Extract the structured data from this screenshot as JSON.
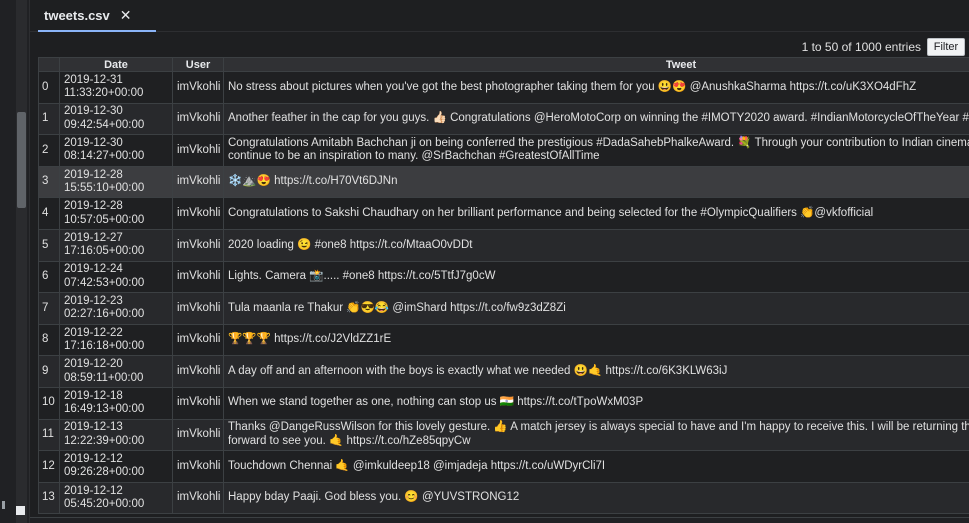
{
  "tab": {
    "title": "tweets.csv",
    "close_glyph": "✕"
  },
  "summary": "1 to 50 of 1000 entries",
  "filter_label": "Filter",
  "columns": [
    "",
    "Date",
    "User",
    "Tweet"
  ],
  "rows": [
    {
      "idx": "0",
      "date": "2019-12-31\n11:33:20+00:00",
      "user": "imVkohli",
      "tweet": "No stress about pictures when you've got the best photographer taking them for you 😃😍 @AnushkaSharma https://t.co/uK3XO4dFhZ"
    },
    {
      "idx": "1",
      "date": "2019-12-30\n09:42:54+00:00",
      "user": "imVkohli",
      "tweet": "Another feather in the cap for you guys. 👍🏻 Congratulations @HeroMotoCorp on winning the #IMOTY2020 award. #IndianMotorcycleOfTheYear #MakeNewTracks"
    },
    {
      "idx": "2",
      "date": "2019-12-30\n08:14:27+00:00",
      "user": "imVkohli",
      "tweet": "Congratulations Amitabh Bachchan ji on being conferred the prestigious #DadaSahebPhalkeAward. 💐 Through your contribution to Indian cinema, you have been and still continue to be an inspiration to many. @SrBachchan #GreatestOfAllTime"
    },
    {
      "idx": "3",
      "date": "2019-12-28\n15:55:10+00:00",
      "user": "imVkohli",
      "tweet": "❄️⛰️😍 https://t.co/H70Vt6DJNn"
    },
    {
      "idx": "4",
      "date": "2019-12-28\n10:57:05+00:00",
      "user": "imVkohli",
      "tweet": "Congratulations to Sakshi Chaudhary on her brilliant performance and being selected for the #OlympicQualifiers 👏@vkfofficial"
    },
    {
      "idx": "5",
      "date": "2019-12-27\n17:16:05+00:00",
      "user": "imVkohli",
      "tweet": "2020 loading 😉 #one8 https://t.co/MtaaO0vDDt"
    },
    {
      "idx": "6",
      "date": "2019-12-24\n07:42:53+00:00",
      "user": "imVkohli",
      "tweet": "Lights. Camera 📸..... #one8 https://t.co/5TtfJ7g0cW"
    },
    {
      "idx": "7",
      "date": "2019-12-23\n02:27:16+00:00",
      "user": "imVkohli",
      "tweet": "Tula maanla re Thakur 👏😎😂 @imShard https://t.co/fw9z3dZ8Zi"
    },
    {
      "idx": "8",
      "date": "2019-12-22\n17:16:18+00:00",
      "user": "imVkohli",
      "tweet": "🏆🏆🏆 https://t.co/J2VldZZ1rE"
    },
    {
      "idx": "9",
      "date": "2019-12-20\n08:59:11+00:00",
      "user": "imVkohli",
      "tweet": "A day off and an afternoon with the boys is exactly what we needed 😃🤙 https://t.co/6K3KLW63iJ"
    },
    {
      "idx": "10",
      "date": "2019-12-18\n16:49:13+00:00",
      "user": "imVkohli",
      "tweet": "When we stand together as one, nothing can stop us 🇮🇳 https://t.co/tTpoWxM03P"
    },
    {
      "idx": "11",
      "date": "2019-12-13\n12:22:39+00:00",
      "user": "imVkohli",
      "tweet": "Thanks @DangeRussWilson for this lovely gesture. 👍 A match jersey is always special to have and I'm happy to receive this. I will be returning the favour very soon. 😊 Looking forward to see you. 🤙 https://t.co/hZe85qpyCw"
    },
    {
      "idx": "12",
      "date": "2019-12-12\n09:26:28+00:00",
      "user": "imVkohli",
      "tweet": "Touchdown Chennai 🤙 @imkuldeep18 @imjadeja https://t.co/uWDyrCli7I"
    },
    {
      "idx": "13",
      "date": "2019-12-12\n05:45:20+00:00",
      "user": "imVkohli",
      "tweet": "Happy bday Paaji. God bless you. 😊 @YUVSTRONG12"
    }
  ],
  "highlight_row": "3"
}
